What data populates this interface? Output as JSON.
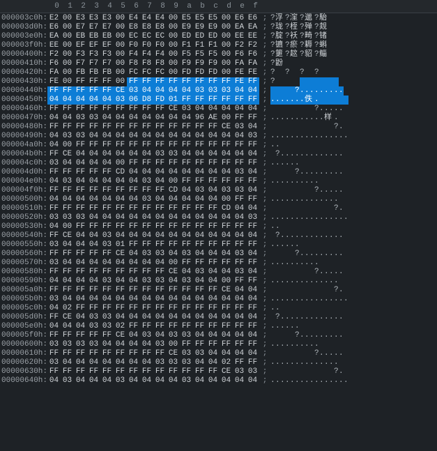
{
  "header_cols": [
    "0",
    "1",
    "2",
    "3",
    "4",
    "5",
    "6",
    "7",
    "8",
    "9",
    "a",
    "b",
    "c",
    "d",
    "e",
    "f"
  ],
  "selection_start": {
    "row_idx": 7,
    "col": 6
  },
  "selection_end": {
    "row_idx": 9,
    "col": 15
  },
  "rows": [
    {
      "addr": "000003c0h:",
      "bytes": [
        "E2",
        "00",
        "E3",
        "E3",
        "E3",
        "00",
        "E4",
        "E4",
        "E4",
        "00",
        "E5",
        "E5",
        "E5",
        "00",
        "E6",
        "E6"
      ],
      "ascii": "?浮?漥?邋?駘"
    },
    {
      "addr": "000003d0h:",
      "bytes": [
        "E6",
        "00",
        "E7",
        "E7",
        "E7",
        "00",
        "E8",
        "E8",
        "E8",
        "00",
        "E9",
        "E9",
        "E9",
        "00",
        "EA",
        "EA"
      ],
      "ascii": "?珑?桎?殚?觌"
    },
    {
      "addr": "000003e0h:",
      "bytes": [
        "EA",
        "00",
        "EB",
        "EB",
        "EB",
        "00",
        "EC",
        "EC",
        "EC",
        "00",
        "ED",
        "ED",
        "ED",
        "00",
        "EE",
        "EE"
      ],
      "ascii": "?腚?袄?畸?锗"
    },
    {
      "addr": "000003f0h:",
      "bytes": [
        "EE",
        "00",
        "EF",
        "EF",
        "EF",
        "00",
        "F0",
        "F0",
        "F0",
        "00",
        "F1",
        "F1",
        "F1",
        "00",
        "F2",
        "F2"
      ],
      "ascii": "?镳?瘀?耨?蝌"
    },
    {
      "addr": "00000400h:",
      "bytes": [
        "F2",
        "00",
        "F3",
        "F3",
        "F3",
        "00",
        "F4",
        "F4",
        "F4",
        "00",
        "F5",
        "F5",
        "F5",
        "00",
        "F6",
        "F6"
      ],
      "ascii": "?筻?趑?貂?鲻"
    },
    {
      "addr": "00000410h:",
      "bytes": [
        "F6",
        "00",
        "F7",
        "F7",
        "F7",
        "00",
        "F8",
        "F8",
        "F8",
        "00",
        "F9",
        "F9",
        "F9",
        "00",
        "FA",
        "FA"
      ],
      "ascii": "?鼢           "
    },
    {
      "addr": "00000420h:",
      "bytes": [
        "FA",
        "00",
        "FB",
        "FB",
        "FB",
        "00",
        "FC",
        "FC",
        "FC",
        "00",
        "FD",
        "FD",
        "FD",
        "00",
        "FE",
        "FE"
      ],
      "ascii": "?  ?  ?  ?"
    },
    {
      "addr": "00000430h:",
      "bytes": [
        "FE",
        "00",
        "FF",
        "FF",
        "FF",
        "00",
        "FF",
        "FF",
        "FF",
        "FF",
        "FF",
        "FF",
        "FF",
        "FF",
        "FE",
        "FF"
      ],
      "ascii": "?             "
    },
    {
      "addr": "00000440h:",
      "bytes": [
        "FF",
        "FF",
        "FF",
        "FF",
        "FF",
        "CE",
        "03",
        "04",
        "04",
        "04",
        "04",
        "03",
        "03",
        "03",
        "04",
        "04"
      ],
      "ascii": "     ?........."
    },
    {
      "addr": "00000450h:",
      "bytes": [
        "04",
        "04",
        "04",
        "04",
        "04",
        "03",
        "06",
        "D8",
        "FD",
        "01",
        "FF",
        "FF",
        "FF",
        "FF",
        "FF",
        "FF"
      ],
      "ascii": ".......佚.      "
    },
    {
      "addr": "00000460h:",
      "bytes": [
        "FF",
        "FF",
        "FF",
        "FF",
        "FF",
        "FF",
        "FF",
        "FF",
        "FF",
        "CE",
        "03",
        "04",
        "04",
        "04",
        "04",
        "04"
      ],
      "ascii": "         ?....."
    },
    {
      "addr": "00000470h:",
      "bytes": [
        "04",
        "04",
        "03",
        "03",
        "04",
        "04",
        "04",
        "04",
        "04",
        "04",
        "04",
        "96",
        "AE",
        "00",
        "FF",
        "FF"
      ],
      "ascii": "...........样.  "
    },
    {
      "addr": "00000480h:",
      "bytes": [
        "FF",
        "FF",
        "FF",
        "FF",
        "FF",
        "FF",
        "FF",
        "FF",
        "FF",
        "FF",
        "FF",
        "FF",
        "FF",
        "CE",
        "03",
        "04"
      ],
      "ascii": "             ?."
    },
    {
      "addr": "00000490h:",
      "bytes": [
        "04",
        "03",
        "03",
        "04",
        "04",
        "04",
        "04",
        "04",
        "04",
        "04",
        "04",
        "04",
        "04",
        "04",
        "04",
        "03"
      ],
      "ascii": "................"
    },
    {
      "addr": "000004a0h:",
      "bytes": [
        "04",
        "00",
        "FF",
        "FF",
        "FF",
        "FF",
        "FF",
        "FF",
        "FF",
        "FF",
        "FF",
        "FF",
        "FF",
        "FF",
        "FF",
        "FF"
      ],
      "ascii": "..              "
    },
    {
      "addr": "000004b0h:",
      "bytes": [
        "FF",
        "CE",
        "04",
        "04",
        "04",
        "04",
        "04",
        "04",
        "03",
        "03",
        "04",
        "04",
        "04",
        "04",
        "04",
        "04"
      ],
      "ascii": " ?............."
    },
    {
      "addr": "000004c0h:",
      "bytes": [
        "03",
        "04",
        "04",
        "04",
        "04",
        "00",
        "FF",
        "FF",
        "FF",
        "FF",
        "FF",
        "FF",
        "FF",
        "FF",
        "FF",
        "FF"
      ],
      "ascii": "......          "
    },
    {
      "addr": "000004d0h:",
      "bytes": [
        "FF",
        "FF",
        "FF",
        "FF",
        "FF",
        "CD",
        "04",
        "04",
        "04",
        "04",
        "04",
        "04",
        "04",
        "04",
        "03",
        "04"
      ],
      "ascii": "     ?........."
    },
    {
      "addr": "000004e0h:",
      "bytes": [
        "04",
        "03",
        "04",
        "04",
        "04",
        "04",
        "04",
        "03",
        "04",
        "00",
        "FF",
        "FF",
        "FF",
        "FF",
        "FF",
        "FF"
      ],
      "ascii": "..........      "
    },
    {
      "addr": "000004f0h:",
      "bytes": [
        "FF",
        "FF",
        "FF",
        "FF",
        "FF",
        "FF",
        "FF",
        "FF",
        "FF",
        "CD",
        "04",
        "03",
        "04",
        "03",
        "03",
        "04"
      ],
      "ascii": "         ?....."
    },
    {
      "addr": "00000500h:",
      "bytes": [
        "04",
        "04",
        "04",
        "04",
        "04",
        "04",
        "04",
        "03",
        "04",
        "04",
        "04",
        "04",
        "04",
        "00",
        "FF",
        "FF"
      ],
      "ascii": "..............  "
    },
    {
      "addr": "00000510h:",
      "bytes": [
        "FF",
        "FF",
        "FF",
        "FF",
        "FF",
        "FF",
        "FF",
        "FF",
        "FF",
        "FF",
        "FF",
        "FF",
        "FF",
        "CD",
        "04",
        "04"
      ],
      "ascii": "             ?."
    },
    {
      "addr": "00000520h:",
      "bytes": [
        "03",
        "03",
        "03",
        "04",
        "04",
        "04",
        "04",
        "04",
        "04",
        "04",
        "04",
        "04",
        "04",
        "04",
        "04",
        "03"
      ],
      "ascii": "................"
    },
    {
      "addr": "00000530h:",
      "bytes": [
        "04",
        "00",
        "FF",
        "FF",
        "FF",
        "FF",
        "FF",
        "FF",
        "FF",
        "FF",
        "FF",
        "FF",
        "FF",
        "FF",
        "FF",
        "FF"
      ],
      "ascii": "..              "
    },
    {
      "addr": "00000540h:",
      "bytes": [
        "FF",
        "CE",
        "04",
        "04",
        "03",
        "04",
        "04",
        "04",
        "04",
        "04",
        "04",
        "04",
        "04",
        "04",
        "04",
        "04"
      ],
      "ascii": " ?............."
    },
    {
      "addr": "00000550h:",
      "bytes": [
        "03",
        "04",
        "04",
        "04",
        "03",
        "01",
        "FF",
        "FF",
        "FF",
        "FF",
        "FF",
        "FF",
        "FF",
        "FF",
        "FF",
        "FF"
      ],
      "ascii": "......          "
    },
    {
      "addr": "00000560h:",
      "bytes": [
        "FF",
        "FF",
        "FF",
        "FF",
        "FF",
        "CE",
        "04",
        "03",
        "03",
        "04",
        "03",
        "04",
        "04",
        "04",
        "03",
        "04"
      ],
      "ascii": "     ?........."
    },
    {
      "addr": "00000570h:",
      "bytes": [
        "03",
        "04",
        "04",
        "04",
        "04",
        "04",
        "04",
        "04",
        "04",
        "00",
        "FF",
        "FF",
        "FF",
        "FF",
        "FF",
        "FF"
      ],
      "ascii": "..........      "
    },
    {
      "addr": "00000580h:",
      "bytes": [
        "FF",
        "FF",
        "FF",
        "FF",
        "FF",
        "FF",
        "FF",
        "FF",
        "FF",
        "CE",
        "04",
        "03",
        "04",
        "04",
        "03",
        "04"
      ],
      "ascii": "         ?....."
    },
    {
      "addr": "00000590h:",
      "bytes": [
        "04",
        "04",
        "04",
        "04",
        "03",
        "04",
        "04",
        "03",
        "03",
        "04",
        "03",
        "04",
        "04",
        "00",
        "FF",
        "FF"
      ],
      "ascii": "..............  "
    },
    {
      "addr": "000005a0h:",
      "bytes": [
        "FF",
        "FF",
        "FF",
        "FF",
        "FF",
        "FF",
        "FF",
        "FF",
        "FF",
        "FF",
        "FF",
        "FF",
        "FF",
        "CE",
        "04",
        "04"
      ],
      "ascii": "             ?."
    },
    {
      "addr": "000005b0h:",
      "bytes": [
        "03",
        "04",
        "04",
        "04",
        "04",
        "04",
        "04",
        "04",
        "04",
        "04",
        "04",
        "04",
        "04",
        "04",
        "04",
        "04"
      ],
      "ascii": "................"
    },
    {
      "addr": "000005c0h:",
      "bytes": [
        "04",
        "02",
        "FF",
        "FF",
        "FF",
        "FF",
        "FF",
        "FF",
        "FF",
        "FF",
        "FF",
        "FF",
        "FF",
        "FF",
        "FF",
        "FF"
      ],
      "ascii": "..              "
    },
    {
      "addr": "000005d0h:",
      "bytes": [
        "FF",
        "CE",
        "04",
        "03",
        "03",
        "04",
        "04",
        "04",
        "04",
        "04",
        "04",
        "04",
        "04",
        "04",
        "04",
        "04"
      ],
      "ascii": " ?............."
    },
    {
      "addr": "000005e0h:",
      "bytes": [
        "04",
        "04",
        "04",
        "03",
        "03",
        "02",
        "FF",
        "FF",
        "FF",
        "FF",
        "FF",
        "FF",
        "FF",
        "FF",
        "FF",
        "FF"
      ],
      "ascii": "......          "
    },
    {
      "addr": "000005f0h:",
      "bytes": [
        "FF",
        "FF",
        "FF",
        "FF",
        "FF",
        "CE",
        "04",
        "03",
        "04",
        "03",
        "03",
        "04",
        "04",
        "04",
        "04",
        "04"
      ],
      "ascii": "     ?........."
    },
    {
      "addr": "00000600h:",
      "bytes": [
        "03",
        "03",
        "03",
        "03",
        "04",
        "04",
        "04",
        "04",
        "03",
        "00",
        "FF",
        "FF",
        "FF",
        "FF",
        "FF",
        "FF"
      ],
      "ascii": "..........      "
    },
    {
      "addr": "00000610h:",
      "bytes": [
        "FF",
        "FF",
        "FF",
        "FF",
        "FF",
        "FF",
        "FF",
        "FF",
        "FF",
        "CE",
        "03",
        "03",
        "04",
        "04",
        "04",
        "04"
      ],
      "ascii": "         ?....."
    },
    {
      "addr": "00000620h:",
      "bytes": [
        "03",
        "04",
        "04",
        "04",
        "04",
        "04",
        "04",
        "04",
        "03",
        "03",
        "03",
        "04",
        "04",
        "02",
        "FF",
        "FF"
      ],
      "ascii": "..............  "
    },
    {
      "addr": "00000630h:",
      "bytes": [
        "FF",
        "FF",
        "FF",
        "FF",
        "FF",
        "FF",
        "FF",
        "FF",
        "FF",
        "FF",
        "FF",
        "FF",
        "FF",
        "CE",
        "03",
        "03"
      ],
      "ascii": "             ?."
    },
    {
      "addr": "00000640h:",
      "bytes": [
        "04",
        "03",
        "04",
        "04",
        "04",
        "03",
        "04",
        "04",
        "04",
        "04",
        "03",
        "04",
        "04",
        "04",
        "04",
        "04"
      ],
      "ascii": "................"
    }
  ]
}
